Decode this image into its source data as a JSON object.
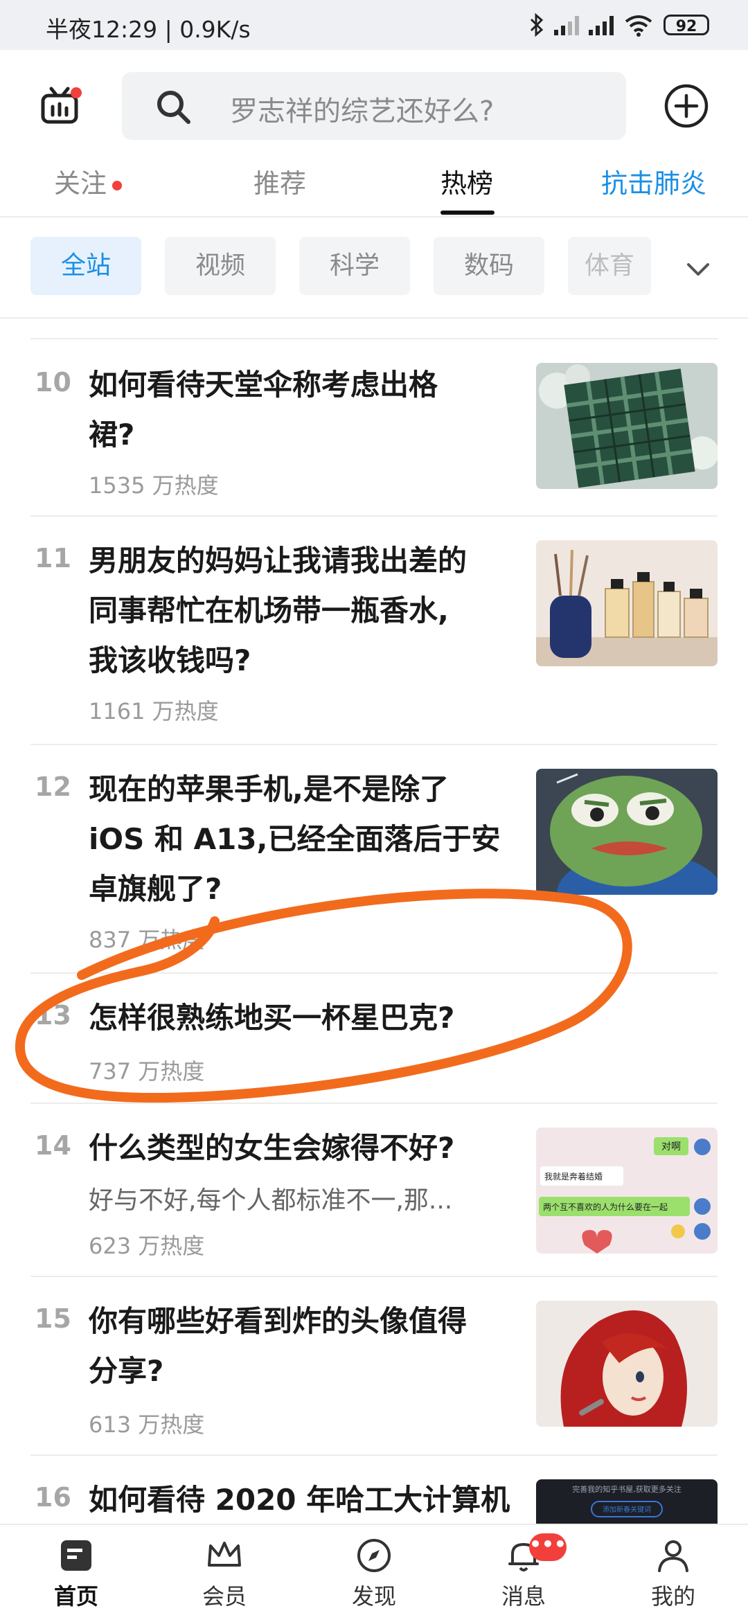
{
  "status_bar": {
    "time_speed": "半夜12:29 | 0.9K/s",
    "battery": "92"
  },
  "header": {
    "search_placeholder": "罗志祥的综艺还好么?"
  },
  "tabs": [
    {
      "label": "关注",
      "has_dot": true
    },
    {
      "label": "推荐"
    },
    {
      "label": "热榜",
      "active": true
    },
    {
      "label": "抗击肺炎",
      "highlight": "#1a8fe3"
    }
  ],
  "chips": [
    "全站",
    "视频",
    "科学",
    "数码",
    "体育"
  ],
  "list": [
    {
      "rank": "10",
      "title_lines": [
        "如何看待天堂伞称考虑出格",
        "裙?"
      ],
      "heat": "1535 万热度"
    },
    {
      "rank": "11",
      "title_lines": [
        "男朋友的妈妈让我请我出差的",
        "同事帮忙在机场带一瓶香水,",
        "我该收钱吗?"
      ],
      "heat": "1161 万热度"
    },
    {
      "rank": "12",
      "title_lines": [
        "现在的苹果手机,是不是除了",
        "iOS 和 A13,已经全面落后于安",
        "卓旗舰了?"
      ],
      "heat": "837 万热度"
    },
    {
      "rank": "13",
      "title_lines": [
        "怎样很熟练地买一杯星巴克?"
      ],
      "heat": "737 万热度"
    },
    {
      "rank": "14",
      "title_lines": [
        "什么类型的女生会嫁得不好?"
      ],
      "excerpt": "好与不好,每个人都标准不一,那...",
      "heat": "623 万热度"
    },
    {
      "rank": "15",
      "title_lines": [
        "你有哪些好看到炸的头像值得",
        "分享?"
      ],
      "heat": "613 万热度"
    },
    {
      "rank": "16",
      "title_lines": [
        "如何看待 2020 年哈工大计算机"
      ]
    }
  ],
  "thumb14": {
    "bubble1": "对啊",
    "bubble2": "我就是奔着结婚",
    "bubble3": "两个互不喜欢的人为什么要在一起"
  },
  "thumb16": {
    "line1": "完善我的知乎书屋,获取更多关注",
    "line2": "添加新春关键词"
  },
  "bottom_nav": [
    {
      "label": "首页",
      "icon": "home-doc-icon",
      "active": true
    },
    {
      "label": "会员",
      "icon": "crown-icon"
    },
    {
      "label": "发现",
      "icon": "compass-icon"
    },
    {
      "label": "消息",
      "icon": "bell-icon",
      "badge": "•••"
    },
    {
      "label": "我的",
      "icon": "person-icon"
    }
  ],
  "colors": {
    "accent": "#1a8fe3",
    "annotation": "#f26b1d",
    "badge": "#f1403c"
  }
}
